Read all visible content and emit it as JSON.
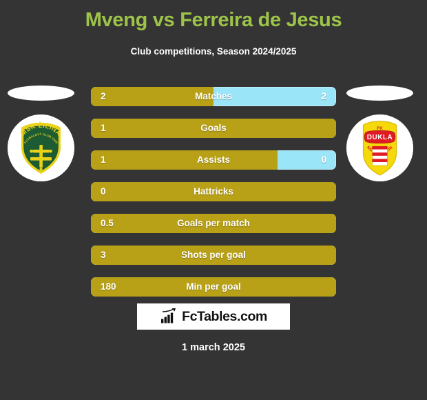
{
  "header": {
    "title": "Mveng vs Ferreira de Jesus",
    "subtitle": "Club competitions, Season 2024/2025",
    "title_color": "#9dc449"
  },
  "teams": {
    "left": {
      "name": "MŠK Žilina",
      "crest_name": "msk-zilina-crest",
      "crest_top_text": "MŠK ŽILINA",
      "crest_sub_text": "FUTBALOVÝ KLUB 1908",
      "colors": {
        "shield": "#1d5b33",
        "border": "#e9d218",
        "cross": "#e9d218"
      }
    },
    "right": {
      "name": "FK Dukla Banská Bystrica",
      "crest_name": "fk-dukla-banska-bystrica-crest",
      "crest_top_text": "FK",
      "crest_main_text": "DUKLA",
      "crest_sub_text": "BANSKÁ BYSTRICA",
      "colors": {
        "shield": "#f5d90a",
        "banner": "#e01b24",
        "stripe": "#e01b24"
      }
    }
  },
  "chart_data": {
    "type": "bar",
    "title": "Mveng vs Ferreira de Jesus",
    "subtitle": "Club competitions, Season 2024/2025",
    "orientation": "horizontal-split",
    "series": [
      {
        "name": "Mveng",
        "color": "#b8a117"
      },
      {
        "name": "Ferreira de Jesus",
        "color": "#9be5f8"
      }
    ],
    "categories": [
      "Matches",
      "Goals",
      "Assists",
      "Hattricks",
      "Goals per match",
      "Shots per goal",
      "Min per goal"
    ],
    "rows": [
      {
        "label": "Matches",
        "left": "2",
        "right": "2",
        "left_pct": 50,
        "has_right": true
      },
      {
        "label": "Goals",
        "left": "1",
        "right": "",
        "left_pct": 100,
        "has_right": false
      },
      {
        "label": "Assists",
        "left": "1",
        "right": "0",
        "left_pct": 76,
        "has_right": true
      },
      {
        "label": "Hattricks",
        "left": "0",
        "right": "",
        "left_pct": 100,
        "has_right": false
      },
      {
        "label": "Goals per match",
        "left": "0.5",
        "right": "",
        "left_pct": 100,
        "has_right": false
      },
      {
        "label": "Shots per goal",
        "left": "3",
        "right": "",
        "left_pct": 100,
        "has_right": false
      },
      {
        "label": "Min per goal",
        "left": "180",
        "right": "",
        "left_pct": 100,
        "has_right": false
      }
    ]
  },
  "footer": {
    "brand": "FcTables.com",
    "brand_icon": "bar-chart-arrow-icon",
    "date": "1 march 2025"
  },
  "colors": {
    "background": "#343434",
    "accent_gold": "#b8a117",
    "accent_blue": "#9be5f8",
    "title_green": "#9dc449"
  }
}
